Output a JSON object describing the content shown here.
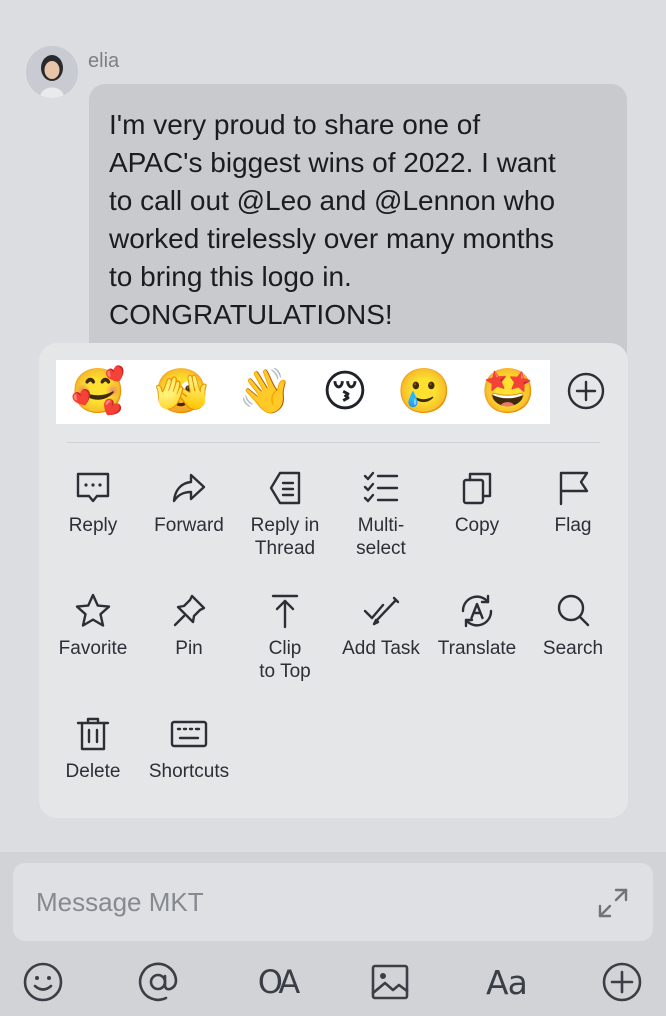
{
  "message": {
    "sender": "elia",
    "text": "I'm very proud to share one of\nAPAC's biggest wins of 2022. I want\nto call out @Leo and @Lennon who\nworked tirelessly over many months\nto bring this logo in.\nCONGRATULATIONS!"
  },
  "reactions": {
    "emojis": [
      "🥰",
      "🫣",
      "👋",
      "😚",
      "🥲",
      "🤩"
    ],
    "add_icon": "plus-circle-icon"
  },
  "actions": [
    {
      "label": "Reply",
      "icon": "reply-icon"
    },
    {
      "label": "Forward",
      "icon": "forward-icon"
    },
    {
      "label": "Reply in\nThread",
      "icon": "thread-icon"
    },
    {
      "label": "Multi-\nselect",
      "icon": "multiselect-icon"
    },
    {
      "label": "Copy",
      "icon": "copy-icon"
    },
    {
      "label": "Flag",
      "icon": "flag-icon"
    },
    {
      "label": "Favorite",
      "icon": "star-icon"
    },
    {
      "label": "Pin",
      "icon": "pin-icon"
    },
    {
      "label": "Clip\nto Top",
      "icon": "clip-to-top-icon"
    },
    {
      "label": "Add Task",
      "icon": "task-icon"
    },
    {
      "label": "Translate",
      "icon": "translate-icon"
    },
    {
      "label": "Search",
      "icon": "search-icon"
    },
    {
      "label": "Delete",
      "icon": "trash-icon"
    },
    {
      "label": "Shortcuts",
      "icon": "keyboard-icon"
    }
  ],
  "composer": {
    "placeholder": "Message MKT",
    "expand_icon": "expand-icon"
  },
  "toolbar": {
    "icons": [
      "emoji-icon",
      "mention-icon",
      "oa-icon",
      "image-icon",
      "text-format-icon",
      "plus-circle-icon"
    ],
    "oa_label": "OA",
    "format_label": "Aa"
  }
}
